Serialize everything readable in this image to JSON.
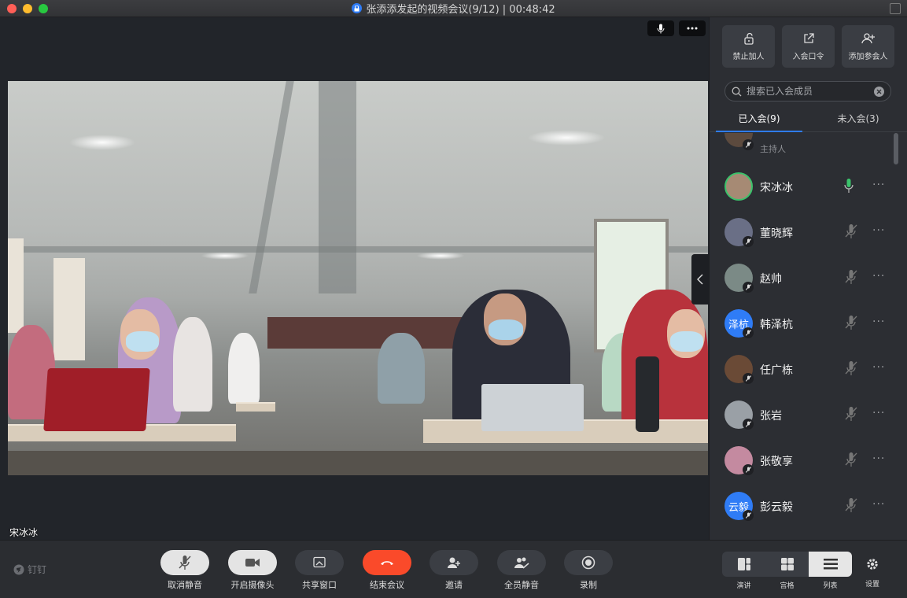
{
  "window": {
    "title": "张添添发起的视频会议(9/12) | 00:48:42"
  },
  "stage": {
    "speaker_name": "宋冰冰",
    "top_buttons": [
      "mic-icon",
      "more-icon"
    ]
  },
  "panel": {
    "actions": [
      {
        "label": "禁止加人",
        "icon": "unlock-icon"
      },
      {
        "label": "入会口令",
        "icon": "share-link-icon"
      },
      {
        "label": "添加参会人",
        "icon": "add-user-icon"
      }
    ],
    "search_placeholder": "搜索已入会成员",
    "tabs": [
      {
        "label": "已入会(9)",
        "active": true
      },
      {
        "label": "未入会(3)",
        "active": false
      }
    ],
    "members": [
      {
        "name": "",
        "role": "主持人",
        "avatar": "photo",
        "color": "#5c4a3e",
        "mic": "muted"
      },
      {
        "name": "宋冰冰",
        "role": "",
        "avatar": "photo",
        "color": "#a68a74",
        "mic": "active"
      },
      {
        "name": "董晓辉",
        "role": "",
        "avatar": "photo",
        "color": "#6a6f86",
        "mic": "muted"
      },
      {
        "name": "赵帅",
        "role": "",
        "avatar": "photo",
        "color": "#7b8a86",
        "mic": "muted"
      },
      {
        "name": "韩泽杭",
        "role": "",
        "avatar": "text",
        "avatar_text": "泽杭",
        "color": "#2f7cf6",
        "mic": "muted"
      },
      {
        "name": "任广栋",
        "role": "",
        "avatar": "photo",
        "color": "#6a4a36",
        "mic": "muted"
      },
      {
        "name": "张岩",
        "role": "",
        "avatar": "photo",
        "color": "#9aa0a6",
        "mic": "muted"
      },
      {
        "name": "张敬享",
        "role": "",
        "avatar": "photo",
        "color": "#c48aa0",
        "mic": "muted"
      },
      {
        "name": "彭云毅",
        "role": "",
        "avatar": "text",
        "avatar_text": "云毅",
        "color": "#2f7cf6",
        "mic": "muted"
      }
    ]
  },
  "toolbar": {
    "brand": "钉钉",
    "controls": [
      {
        "label": "取消静音",
        "icon": "mic-off-icon",
        "style": "light"
      },
      {
        "label": "开启摄像头",
        "icon": "camera-icon",
        "style": "light"
      },
      {
        "label": "共享窗口",
        "icon": "share-screen-icon",
        "style": "dark"
      },
      {
        "label": "结束会议",
        "icon": "hang-up-icon",
        "style": "end"
      },
      {
        "label": "邀请",
        "icon": "invite-icon",
        "style": "dark"
      },
      {
        "label": "全员静音",
        "icon": "mute-all-icon",
        "style": "dark"
      },
      {
        "label": "录制",
        "icon": "record-icon",
        "style": "dark"
      }
    ],
    "layouts": [
      {
        "label": "演讲",
        "icon": "speaker-layout-icon",
        "active": false
      },
      {
        "label": "宫格",
        "icon": "grid-layout-icon",
        "active": false
      },
      {
        "label": "列表",
        "icon": "list-layout-icon",
        "active": true
      }
    ],
    "settings_label": "设置"
  },
  "colors": {
    "accent": "#2f7cf6",
    "end_call": "#fa4a2a",
    "active_mic": "#3bc26b"
  }
}
